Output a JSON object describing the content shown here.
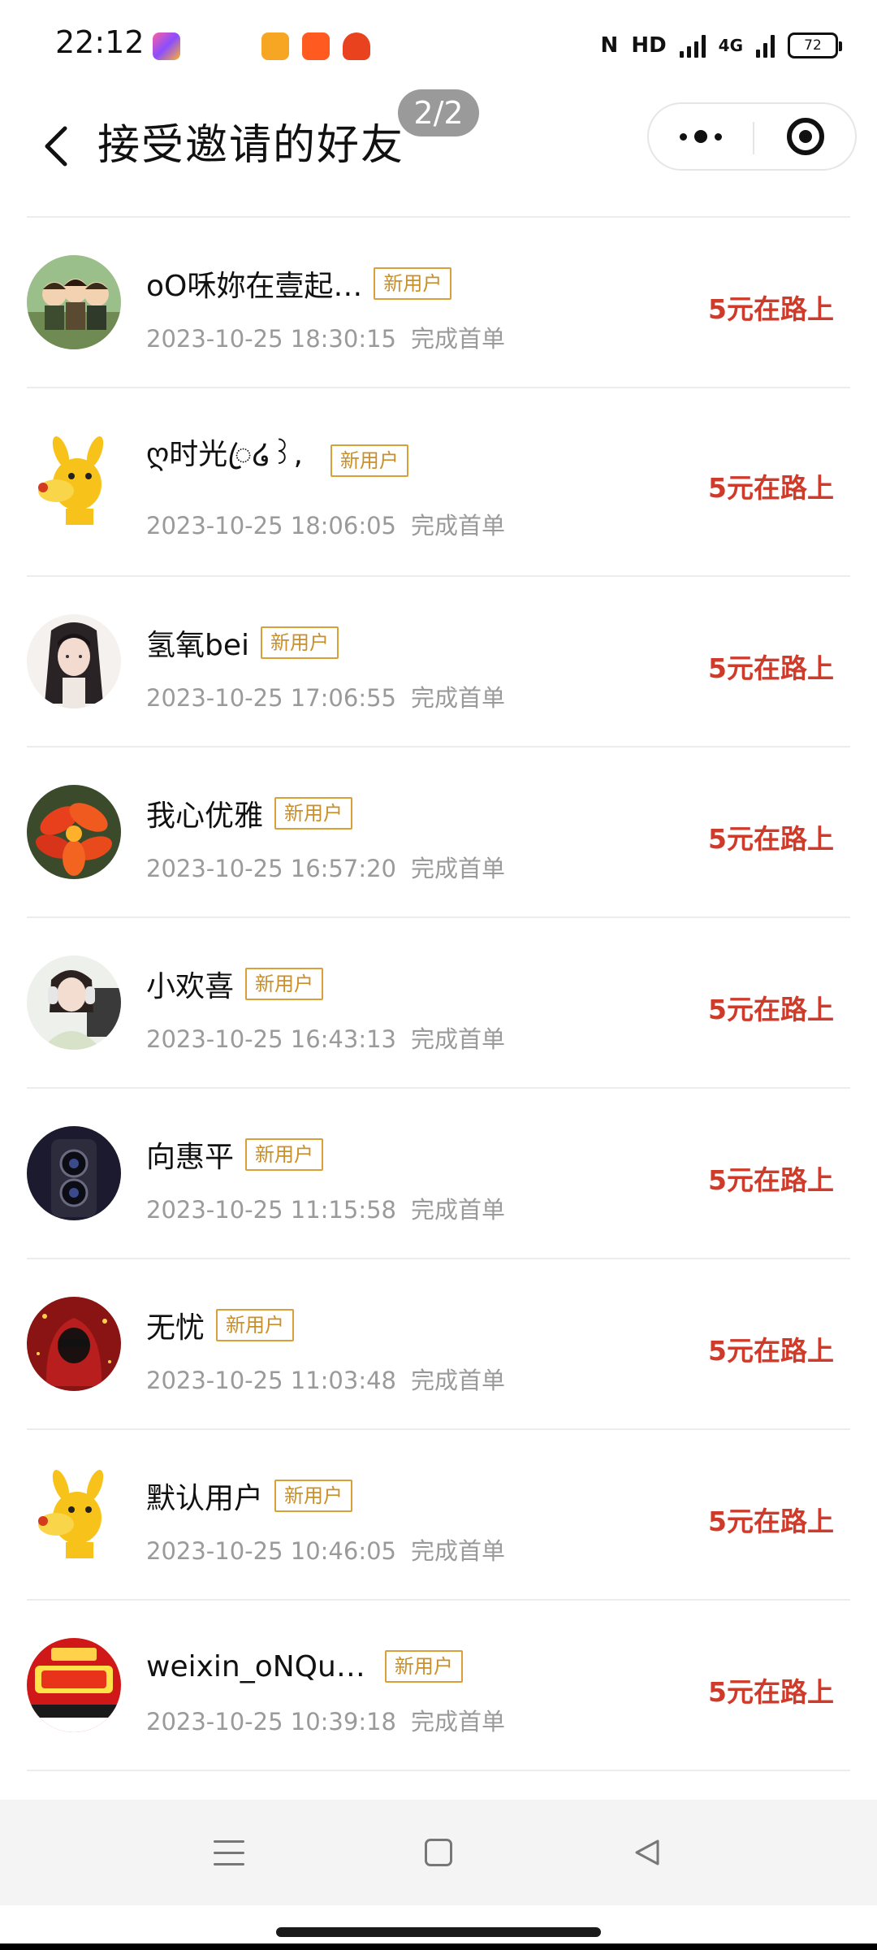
{
  "status_bar": {
    "time": "22:12",
    "network": "4G",
    "battery": "72"
  },
  "header": {
    "title": "接受邀请的好友",
    "page_indicator": "2/2"
  },
  "tag_label": "新用户",
  "friends": [
    {
      "name": "oO咊妳在壹起…",
      "datetime": "2023-10-25 18:30:15",
      "status": "完成首单",
      "reward": "5元在路上",
      "avatar_icon": "cartoon-kids-avatar"
    },
    {
      "name": "ღ时光ꦿ໒꒱,",
      "datetime": "2023-10-25 18:06:05",
      "status": "完成首单",
      "reward": "5元在路上",
      "avatar_icon": "yellow-dog-avatar"
    },
    {
      "name": "氢氧bei",
      "datetime": "2023-10-25 17:06:55",
      "status": "完成首单",
      "reward": "5元在路上",
      "avatar_icon": "ink-portrait-avatar"
    },
    {
      "name": "我心优雅",
      "datetime": "2023-10-25 16:57:20",
      "status": "完成首单",
      "reward": "5元在路上",
      "avatar_icon": "red-flower-avatar"
    },
    {
      "name": "小欢喜",
      "datetime": "2023-10-25 16:43:13",
      "status": "完成首单",
      "reward": "5元在路上",
      "avatar_icon": "girl-headphones-avatar"
    },
    {
      "name": "向惠平",
      "datetime": "2023-10-25 11:15:58",
      "status": "完成首单",
      "reward": "5元在路上",
      "avatar_icon": "phone-camera-avatar"
    },
    {
      "name": "无忧",
      "datetime": "2023-10-25 11:03:48",
      "status": "完成首单",
      "reward": "5元在路上",
      "avatar_icon": "red-hood-avatar"
    },
    {
      "name": "默认用户",
      "datetime": "2023-10-25 10:46:05",
      "status": "完成首单",
      "reward": "5元在路上",
      "avatar_icon": "yellow-dog-avatar"
    },
    {
      "name": "weixin_oNQu…",
      "datetime": "2023-10-25 10:39:18",
      "status": "完成首单",
      "reward": "5元在路上",
      "avatar_icon": "festival-sale-avatar"
    }
  ],
  "colors": {
    "reward": "#cf3b2b",
    "tag": "#d9a03a",
    "muted": "#9a9a9a"
  }
}
